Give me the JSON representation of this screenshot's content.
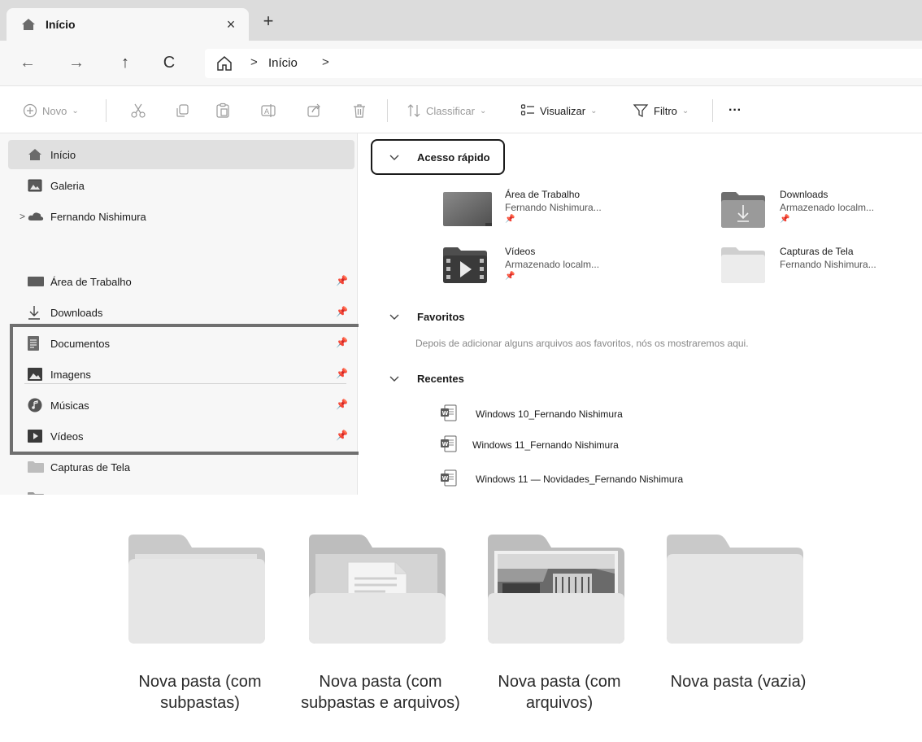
{
  "tab": {
    "title": "Início",
    "close": "×",
    "new": "+"
  },
  "nav": {
    "back": "←",
    "forward": "→",
    "up": "↑",
    "refresh": "C"
  },
  "address": {
    "separator": ">",
    "crumb": "Início"
  },
  "toolbar": {
    "new_label": "Novo",
    "sort_label": "Classificar",
    "view_label": "Visualizar",
    "filter_label": "Filtro",
    "more_label": "···",
    "caret": "⌄"
  },
  "sidebar": {
    "items": [
      {
        "label": "Início",
        "icon": "home-icon"
      },
      {
        "label": "Galeria",
        "icon": "gallery-icon"
      },
      {
        "label": "Fernando Nishimura",
        "icon": "cloud-icon"
      },
      {
        "label": "Área de Trabalho",
        "icon": "desktop-icon"
      },
      {
        "label": "Downloads",
        "icon": "download-icon"
      },
      {
        "label": "Documentos",
        "icon": "documents-icon"
      },
      {
        "label": "Imagens",
        "icon": "pictures-icon"
      },
      {
        "label": "Músicas",
        "icon": "music-icon"
      },
      {
        "label": "Vídeos",
        "icon": "videos-icon"
      },
      {
        "label": "Capturas de Tela",
        "icon": "folder-icon"
      }
    ],
    "expand_chevron": ">",
    "pin": "📌"
  },
  "content": {
    "quick_access": {
      "title": "Acesso rápido",
      "items": [
        {
          "name": "Área de Trabalho",
          "sub": "Fernando Nishimura...",
          "icon": "desktop-folder-icon"
        },
        {
          "name": "Downloads",
          "sub": "Armazenado localm...",
          "icon": "downloads-folder-icon"
        },
        {
          "name": "Vídeos",
          "sub": "Armazenado localm...",
          "icon": "videos-folder-icon"
        },
        {
          "name": "Capturas de Tela",
          "sub": "Fernando Nishimura...",
          "icon": "folder-icon"
        }
      ]
    },
    "favorites": {
      "title": "Favoritos",
      "message": "Depois de adicionar alguns arquivos aos favoritos, nós os mostraremos aqui."
    },
    "recent": {
      "title": "Recentes",
      "items": [
        "Windows 10_Fernando Nishimura",
        "Windows 11_Fernando Nishimura",
        "Windows 11 — Novidades_Fernando Nishimura"
      ]
    }
  },
  "folders": [
    {
      "label": "Nova pasta (com subpastas)",
      "icon": "folder-with-subfolders-icon"
    },
    {
      "label": "Nova pasta (com subpastas e arquivos)",
      "icon": "folder-with-subfolders-and-files-icon"
    },
    {
      "label": "Nova pasta (com arquivos)",
      "icon": "folder-with-files-icon"
    },
    {
      "label": "Nova pasta (vazia)",
      "icon": "empty-folder-icon"
    }
  ],
  "colors": {
    "chrome": "#dcdcdc",
    "sidebar": "#f7f7f7",
    "highlight_border": "#6f6f6f"
  }
}
